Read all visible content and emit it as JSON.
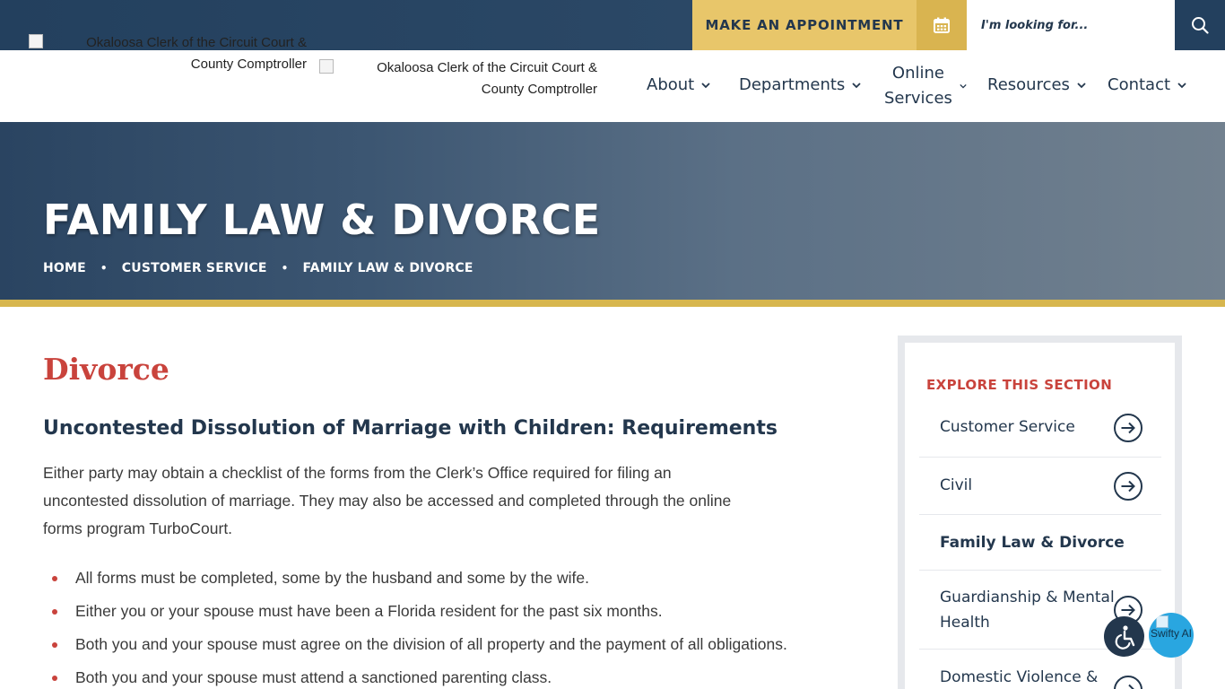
{
  "header": {
    "appointment_label": "MAKE AN APPOINTMENT",
    "calendar_icon": "calendar-icon",
    "search_placeholder": "I'm looking for...",
    "search_icon": "search-icon"
  },
  "logos": [
    {
      "alt_line1": "Okaloosa Clerk of the Circuit Court &",
      "alt_line2": "County Comptroller"
    },
    {
      "alt_line1": "Okaloosa Clerk of the Circuit Court &",
      "alt_line2": "County Comptroller"
    }
  ],
  "nav": {
    "items": [
      {
        "label": "About"
      },
      {
        "label": "Departments"
      },
      {
        "label_line1": "Online",
        "label_line2": "Services"
      },
      {
        "label": "Resources"
      },
      {
        "label": "Contact"
      }
    ]
  },
  "hero": {
    "title": "FAMILY LAW & DIVORCE",
    "breadcrumb": [
      "HOME",
      "CUSTOMER SERVICE",
      "FAMILY LAW & DIVORCE"
    ]
  },
  "content": {
    "heading": "Divorce",
    "subheading": "Uncontested Dissolution of Marriage with Children: Requirements",
    "intro": "Either party may obtain a checklist of the forms from the Clerk’s Office required for filing an uncontested dissolution of marriage. They may also be accessed and completed through the online forms program TurboCourt.",
    "bullets": [
      "All forms must be completed, some by the husband and some by the wife.",
      "Either you or your spouse must have been a Florida resident for the past six months.",
      "Both you and your spouse must agree on the division of all property and the payment of all obligations.",
      "Both you and your spouse must attend a sanctioned parenting class."
    ]
  },
  "sidebar": {
    "heading": "EXPLORE THIS SECTION",
    "items": [
      {
        "label": "Customer Service"
      },
      {
        "label": "Civil"
      },
      {
        "label": "Family Law & Divorce"
      },
      {
        "label_line1": "Guardianship & Mental",
        "label_line2": "Health"
      },
      {
        "label_line1": "Domestic Violence &",
        "label_line2": ""
      }
    ]
  },
  "widgets": {
    "accessibility_icon": "wheelchair-icon",
    "swifty_alt": "Swifty AI"
  },
  "colors": {
    "navy": "#23374d",
    "gold": "#e8c66a",
    "accent_red": "#c9433c",
    "hero_bar": "#d7b64e",
    "swifty_blue": "#29a6e0"
  }
}
